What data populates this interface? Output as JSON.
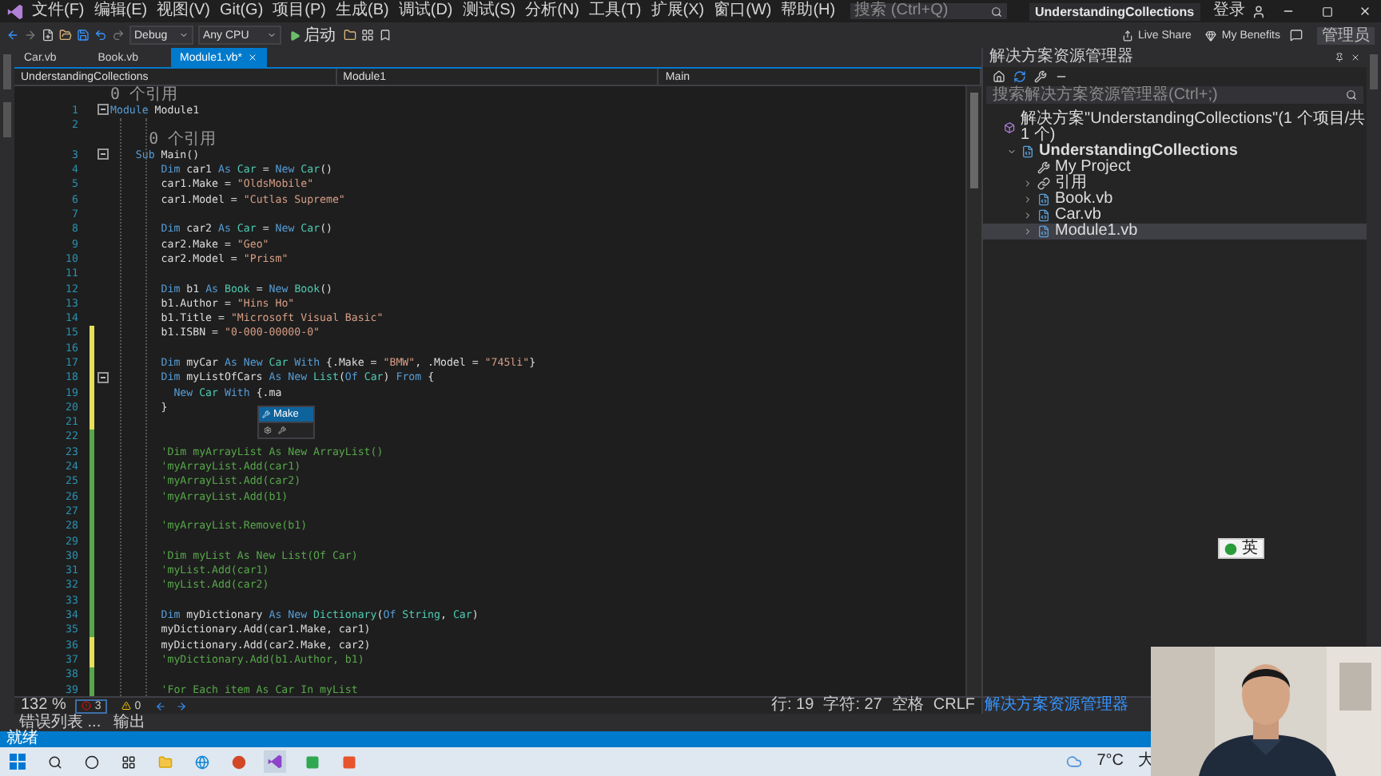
{
  "menu_bar": {
    "menus": [
      "文件(F)",
      "编辑(E)",
      "视图(V)",
      "Git(G)",
      "项目(P)",
      "生成(B)",
      "调试(D)",
      "测试(S)",
      "分析(N)",
      "工具(T)",
      "扩展(X)",
      "窗口(W)",
      "帮助(H)"
    ],
    "search": {
      "placeholder": "搜索 (Ctrl+Q)"
    },
    "title": "UnderstandingCollections",
    "sign_in": "登录"
  },
  "toolbar": {
    "configuration": "Debug",
    "platform": "Any CPU",
    "start": "启动",
    "live_share": "Live Share",
    "benefits": "My Benefits",
    "admin": "管理员"
  },
  "doc_tabs": [
    {
      "label": "Car.vb",
      "selected": false
    },
    {
      "label": "Book.vb",
      "selected": false
    },
    {
      "label": "Module1.vb*",
      "selected": true
    }
  ],
  "nav_bar": {
    "project": "UnderstandingCollections",
    "module": "Module1",
    "member": "Main"
  },
  "code": [
    {
      "kind": "lens",
      "text": "0 个引用"
    },
    {
      "kind": "code",
      "no": "1",
      "fold": true,
      "modified": false,
      "segs": [
        {
          "kind": "kw",
          "text": "Module "
        },
        {
          "kind": "id",
          "text": "Module1"
        }
      ]
    },
    {
      "kind": "code",
      "no": "2",
      "fold": false,
      "modified": false
    },
    {
      "kind": "lens",
      "text": "    0 个引用"
    },
    {
      "kind": "code",
      "no": "3",
      "fold": true,
      "modified": false,
      "segs": [
        {
          "kind": "kw",
          "text": "    Sub "
        },
        {
          "kind": "id",
          "text": "Main()"
        }
      ]
    },
    {
      "kind": "code",
      "no": "4",
      "fold": false,
      "modified": false,
      "segs": [
        {
          "kind": "kw",
          "text": "        Dim "
        },
        {
          "kind": "id",
          "text": "car1 "
        },
        {
          "kind": "kw",
          "text": "As "
        },
        {
          "kind": "type",
          "text": "Car "
        },
        {
          "kind": "id",
          "text": "= "
        },
        {
          "kind": "kw",
          "text": "New "
        },
        {
          "kind": "type",
          "text": "Car"
        },
        {
          "kind": "id",
          "text": "()"
        }
      ]
    },
    {
      "kind": "code",
      "no": "5",
      "fold": false,
      "modified": false,
      "segs": [
        {
          "kind": "id",
          "text": "        car1.Make = "
        },
        {
          "kind": "str",
          "text": "\"OldsMobile\""
        }
      ]
    },
    {
      "kind": "code",
      "no": "6",
      "fold": false,
      "modified": false,
      "segs": [
        {
          "kind": "id",
          "text": "        car1.Model = "
        },
        {
          "kind": "str",
          "text": "\"Cutlas Supreme\""
        }
      ]
    },
    {
      "kind": "code",
      "no": "7",
      "fold": false,
      "modified": false
    },
    {
      "kind": "code",
      "no": "8",
      "fold": false,
      "modified": false,
      "segs": [
        {
          "kind": "kw",
          "text": "        Dim "
        },
        {
          "kind": "id",
          "text": "car2 "
        },
        {
          "kind": "kw",
          "text": "As "
        },
        {
          "kind": "type",
          "text": "Car "
        },
        {
          "kind": "id",
          "text": "= "
        },
        {
          "kind": "kw",
          "text": "New "
        },
        {
          "kind": "type",
          "text": "Car"
        },
        {
          "kind": "id",
          "text": "()"
        }
      ]
    },
    {
      "kind": "code",
      "no": "9",
      "fold": false,
      "modified": false,
      "segs": [
        {
          "kind": "id",
          "text": "        car2.Make = "
        },
        {
          "kind": "str",
          "text": "\"Geo\""
        }
      ]
    },
    {
      "kind": "code",
      "no": "10",
      "fold": false,
      "modified": false,
      "segs": [
        {
          "kind": "id",
          "text": "        car2.Model = "
        },
        {
          "kind": "str",
          "text": "\"Prism\""
        }
      ]
    },
    {
      "kind": "code",
      "no": "11",
      "fold": false,
      "modified": false
    },
    {
      "kind": "code",
      "no": "12",
      "fold": false,
      "modified": false,
      "segs": [
        {
          "kind": "kw",
          "text": "        Dim "
        },
        {
          "kind": "id",
          "text": "b1 "
        },
        {
          "kind": "kw",
          "text": "As "
        },
        {
          "kind": "type",
          "text": "Book "
        },
        {
          "kind": "id",
          "text": "= "
        },
        {
          "kind": "kw",
          "text": "New "
        },
        {
          "kind": "type",
          "text": "Book"
        },
        {
          "kind": "id",
          "text": "()"
        }
      ]
    },
    {
      "kind": "code",
      "no": "13",
      "fold": false,
      "modified": false,
      "segs": [
        {
          "kind": "id",
          "text": "        b1.Author = "
        },
        {
          "kind": "str",
          "text": "\"Hins Ho\""
        }
      ]
    },
    {
      "kind": "code",
      "no": "14",
      "fold": false,
      "modified": false,
      "segs": [
        {
          "kind": "id",
          "text": "        b1.Title = "
        },
        {
          "kind": "str",
          "text": "\"Microsoft Visual Basic\""
        }
      ]
    },
    {
      "kind": "code",
      "no": "15",
      "fold": false,
      "modified": true,
      "saved": false,
      "segs": [
        {
          "kind": "id",
          "text": "        b1.ISBN = "
        },
        {
          "kind": "str",
          "text": "\"0-000-00000-0\""
        }
      ]
    },
    {
      "kind": "code",
      "no": "16",
      "fold": false,
      "modified": true,
      "saved": false
    },
    {
      "kind": "code",
      "no": "17",
      "fold": false,
      "modified": true,
      "saved": false,
      "segs": [
        {
          "kind": "kw",
          "text": "        Dim "
        },
        {
          "kind": "id",
          "text": "myCar "
        },
        {
          "kind": "kw",
          "text": "As New "
        },
        {
          "kind": "type",
          "text": "Car "
        },
        {
          "kind": "kw",
          "text": "With "
        },
        {
          "kind": "id",
          "text": "{.Make = "
        },
        {
          "kind": "str",
          "text": "\"BMW\""
        },
        {
          "kind": "id",
          "text": ", .Model = "
        },
        {
          "kind": "str",
          "text": "\"745li\""
        },
        {
          "kind": "id",
          "text": "}"
        }
      ]
    },
    {
      "kind": "code",
      "no": "18",
      "fold": true,
      "modified": true,
      "saved": false,
      "segs": [
        {
          "kind": "kw",
          "text": "        Dim "
        },
        {
          "kind": "id",
          "text": "myListOfCars "
        },
        {
          "kind": "kw",
          "text": "As New "
        },
        {
          "kind": "type",
          "text": "List"
        },
        {
          "kind": "id",
          "text": "("
        },
        {
          "kind": "kw",
          "text": "Of "
        },
        {
          "kind": "type",
          "text": "Car"
        },
        {
          "kind": "id",
          "text": ") "
        },
        {
          "kind": "kw",
          "text": "From "
        },
        {
          "kind": "id",
          "text": "{"
        }
      ]
    },
    {
      "kind": "code",
      "no": "19",
      "fold": false,
      "modified": true,
      "saved": false,
      "segs": [
        {
          "kind": "kw",
          "text": "          New "
        },
        {
          "kind": "type",
          "text": "Car "
        },
        {
          "kind": "kw",
          "text": "With "
        },
        {
          "kind": "id",
          "text": "{.ma"
        }
      ]
    },
    {
      "kind": "code",
      "no": "20",
      "fold": false,
      "modified": true,
      "saved": false,
      "segs": [
        {
          "kind": "id",
          "text": "        }"
        }
      ]
    },
    {
      "kind": "code",
      "no": "21",
      "fold": false,
      "modified": true,
      "saved": false
    },
    {
      "kind": "code",
      "no": "22",
      "fold": false,
      "modified": true,
      "saved": true
    },
    {
      "kind": "code",
      "no": "23",
      "fold": false,
      "modified": true,
      "saved": true,
      "segs": [
        {
          "kind": "com",
          "text": "        'Dim myArrayList As New ArrayList()"
        }
      ]
    },
    {
      "kind": "code",
      "no": "24",
      "fold": false,
      "modified": true,
      "saved": true,
      "segs": [
        {
          "kind": "com",
          "text": "        'myArrayList.Add(car1)"
        }
      ]
    },
    {
      "kind": "code",
      "no": "25",
      "fold": false,
      "modified": true,
      "saved": true,
      "segs": [
        {
          "kind": "com",
          "text": "        'myArrayList.Add(car2)"
        }
      ]
    },
    {
      "kind": "code",
      "no": "26",
      "fold": false,
      "modified": true,
      "saved": true,
      "segs": [
        {
          "kind": "com",
          "text": "        'myArrayList.Add(b1)"
        }
      ]
    },
    {
      "kind": "code",
      "no": "27",
      "fold": false,
      "modified": true,
      "saved": true
    },
    {
      "kind": "code",
      "no": "28",
      "fold": false,
      "modified": true,
      "saved": true,
      "segs": [
        {
          "kind": "com",
          "text": "        'myArrayList.Remove(b1)"
        }
      ]
    },
    {
      "kind": "code",
      "no": "29",
      "fold": false,
      "modified": true,
      "saved": true
    },
    {
      "kind": "code",
      "no": "30",
      "fold": false,
      "modified": true,
      "saved": true,
      "segs": [
        {
          "kind": "com",
          "text": "        'Dim myList As New List(Of Car)"
        }
      ]
    },
    {
      "kind": "code",
      "no": "31",
      "fold": false,
      "modified": true,
      "saved": true,
      "segs": [
        {
          "kind": "com",
          "text": "        'myList.Add(car1)"
        }
      ]
    },
    {
      "kind": "code",
      "no": "32",
      "fold": false,
      "modified": true,
      "saved": true,
      "segs": [
        {
          "kind": "com",
          "text": "        'myList.Add(car2)"
        }
      ]
    },
    {
      "kind": "code",
      "no": "33",
      "fold": false,
      "modified": true,
      "saved": true
    },
    {
      "kind": "code",
      "no": "34",
      "fold": false,
      "modified": true,
      "saved": true,
      "segs": [
        {
          "kind": "kw",
          "text": "        Dim "
        },
        {
          "kind": "id",
          "text": "myDictionary "
        },
        {
          "kind": "kw",
          "text": "As New "
        },
        {
          "kind": "type",
          "text": "Dictionary"
        },
        {
          "kind": "id",
          "text": "("
        },
        {
          "kind": "kw",
          "text": "Of "
        },
        {
          "kind": "type",
          "text": "String"
        },
        {
          "kind": "id",
          "text": ", "
        },
        {
          "kind": "type",
          "text": "Car"
        },
        {
          "kind": "id",
          "text": ")"
        }
      ]
    },
    {
      "kind": "code",
      "no": "35",
      "fold": false,
      "modified": true,
      "saved": true,
      "segs": [
        {
          "kind": "id",
          "text": "        myDictionary.Add(car1.Make, car1)"
        }
      ]
    },
    {
      "kind": "code",
      "no": "36",
      "fold": false,
      "modified": true,
      "saved": false,
      "segs": [
        {
          "kind": "id",
          "text": "        myDictionary.Add(car2.Make, car2)"
        }
      ]
    },
    {
      "kind": "code",
      "no": "37",
      "fold": false,
      "modified": true,
      "saved": false,
      "segs": [
        {
          "kind": "com",
          "text": "        'myDictionary.Add(b1.Author, b1)"
        }
      ]
    },
    {
      "kind": "code",
      "no": "38",
      "fold": false,
      "modified": true,
      "saved": true
    },
    {
      "kind": "code",
      "no": "39",
      "fold": false,
      "modified": true,
      "saved": true,
      "segs": [
        {
          "kind": "com",
          "text": "        'For Each item As Car In myList"
        }
      ]
    }
  ],
  "completion": {
    "items": [
      {
        "label": "Make",
        "selected": true
      }
    ]
  },
  "editor_status": {
    "zoom": "132 %",
    "errors": "3",
    "warnings": "0",
    "line": "行: 19",
    "column": "字符: 27",
    "indent": "空格",
    "eol": "CRLF"
  },
  "solution_explorer": {
    "title": "解决方案资源管理器",
    "search": {
      "placeholder": "搜索解决方案资源管理器(Ctrl+;)"
    },
    "tab": "解决方案资源管理器",
    "tree": [
      {
        "label": "解决方案\"UnderstandingCollections\"(1 个项目/共 1 个)",
        "kind": "solution",
        "selected": false,
        "children": [
          {
            "label": "UnderstandingCollections",
            "kind": "project",
            "expanded": true,
            "selected": false,
            "children": [
              {
                "label": "My Project",
                "kind": "settings",
                "selected": false
              },
              {
                "label": "引用",
                "kind": "refs",
                "expanded": false,
                "selected": false
              },
              {
                "label": "Book.vb",
                "kind": "vb",
                "expanded": false,
                "selected": false
              },
              {
                "label": "Car.vb",
                "kind": "vb",
                "expanded": false,
                "selected": false
              },
              {
                "label": "Module1.vb",
                "kind": "vb",
                "expanded": false,
                "selected": true
              }
            ]
          }
        ]
      }
    ]
  },
  "ime": {
    "label": "英"
  },
  "bottom_tabs": [
    "错误列表 ...",
    "输出"
  ],
  "status_bar": {
    "text": "就绪"
  },
  "taskbar": {
    "temperature": "7°C",
    "weather": "大"
  },
  "webcam": {
    "kind": "picture"
  }
}
